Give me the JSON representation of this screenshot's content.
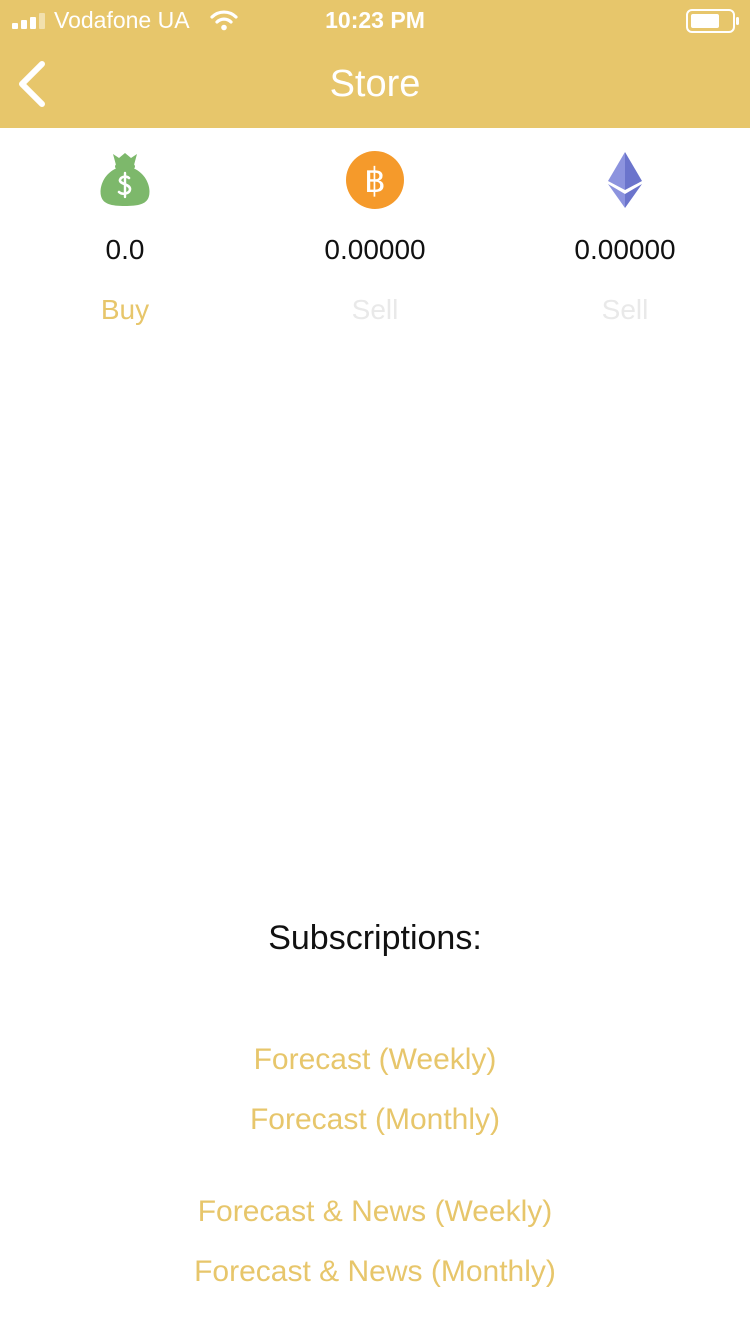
{
  "status_bar": {
    "carrier": "Vodafone UA",
    "time": "10:23 PM"
  },
  "nav": {
    "title": "Store"
  },
  "balances": [
    {
      "icon": "money-bag-icon",
      "value": "0.0",
      "action": "Buy",
      "action_enabled": true
    },
    {
      "icon": "bitcoin-icon",
      "value": "0.00000",
      "action": "Sell",
      "action_enabled": false
    },
    {
      "icon": "ethereum-icon",
      "value": "0.00000",
      "action": "Sell",
      "action_enabled": false
    }
  ],
  "subscriptions": {
    "heading": "Subscriptions:",
    "items": [
      "Forecast (Weekly)",
      "Forecast (Monthly)",
      "Forecast & News (Weekly)",
      "Forecast & News (Monthly)"
    ]
  },
  "colors": {
    "accent": "#e7c66b",
    "bitcoin": "#f59a2b",
    "money_bag": "#7db86b",
    "ethereum": "#7b84d6",
    "disabled_text": "#e9e9e9"
  }
}
